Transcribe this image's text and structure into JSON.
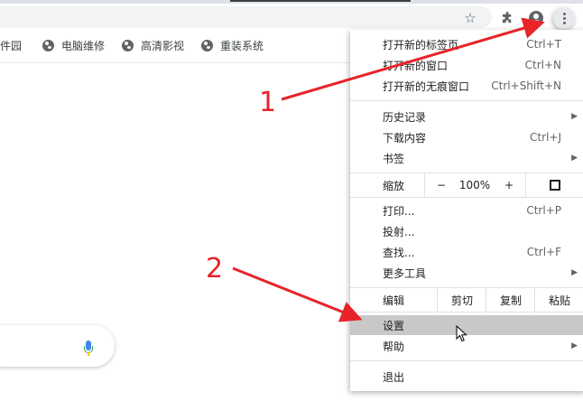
{
  "toolbar": {
    "star_icon": "star-icon",
    "extensions_icon": "puzzle-icon",
    "profile_icon": "profile-icon",
    "menu_icon": "three-dots-icon"
  },
  "bookmarks": [
    {
      "label": "软件园"
    },
    {
      "label": "电脑维修"
    },
    {
      "label": "高清影视"
    },
    {
      "label": "重装系统"
    }
  ],
  "menu": {
    "new_tab": {
      "label": "打开新的标签页",
      "shortcut": "Ctrl+T"
    },
    "new_window": {
      "label": "打开新的窗口",
      "shortcut": "Ctrl+N"
    },
    "new_incognito": {
      "label": "打开新的无痕窗口",
      "shortcut": "Ctrl+Shift+N"
    },
    "history": {
      "label": "历史记录"
    },
    "downloads": {
      "label": "下载内容",
      "shortcut": "Ctrl+J"
    },
    "bookmarks": {
      "label": "书签"
    },
    "zoom": {
      "label": "缩放",
      "minus": "−",
      "value": "100%",
      "plus": "+"
    },
    "print": {
      "label": "打印...",
      "shortcut": "Ctrl+P"
    },
    "cast": {
      "label": "投射..."
    },
    "find": {
      "label": "查找...",
      "shortcut": "Ctrl+F"
    },
    "more_tools": {
      "label": "更多工具"
    },
    "edit": {
      "label": "编辑",
      "cut": "剪切",
      "copy": "复制",
      "paste": "粘贴"
    },
    "settings": {
      "label": "设置"
    },
    "help": {
      "label": "帮助"
    },
    "exit": {
      "label": "退出"
    }
  },
  "annotations": {
    "step1": "1",
    "step2": "2",
    "color": "#e8232a"
  }
}
